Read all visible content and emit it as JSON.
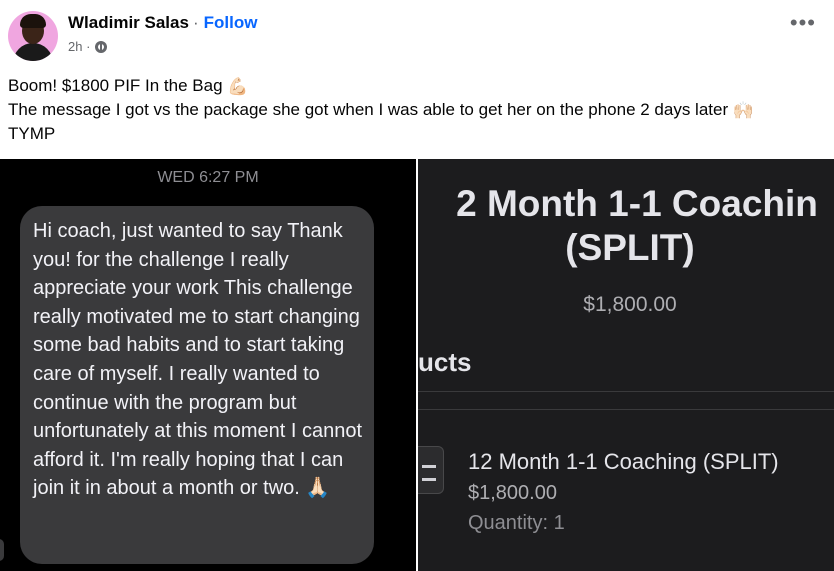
{
  "post": {
    "author": "Wladimir Salas",
    "separator": "·",
    "follow_label": "Follow",
    "time": "2h ·",
    "audience_icon": "globe-icon",
    "more_label": "•••",
    "caption": {
      "line1": "Boom! $1800 PIF In the Bag",
      "line1_emoji": "💪🏻",
      "line2": "The message I got vs the package she got when I was able to get her on the phone 2 days later",
      "line2_emoji": "🙌🏻",
      "line3": "TYMP"
    }
  },
  "message_image": {
    "timestamp": "WED 6:27 PM",
    "text": "Hi coach, just wanted to say Thank you! for the challenge I really appreciate your work This challenge really motivated me to start changing some bad habits and  to start taking care of myself. I really wanted to continue with the program but unfortunately at this moment I cannot afford it. I'm really hoping that I can join it in about a month or two.",
    "emoji": "🙏🏻"
  },
  "package_image": {
    "title_line1": "2 Month 1-1 Coachin",
    "title_line2": "(SPLIT)",
    "price": "$1,800.00",
    "section": "ucts",
    "item_name": "12 Month 1-1 Coaching (SPLIT)",
    "item_price": "$1,800.00",
    "quantity": "Quantity: 1"
  },
  "colors": {
    "follow": "#0866ff",
    "bubble": "#3a3a3c",
    "dark_bg": "#1c1c1e"
  }
}
